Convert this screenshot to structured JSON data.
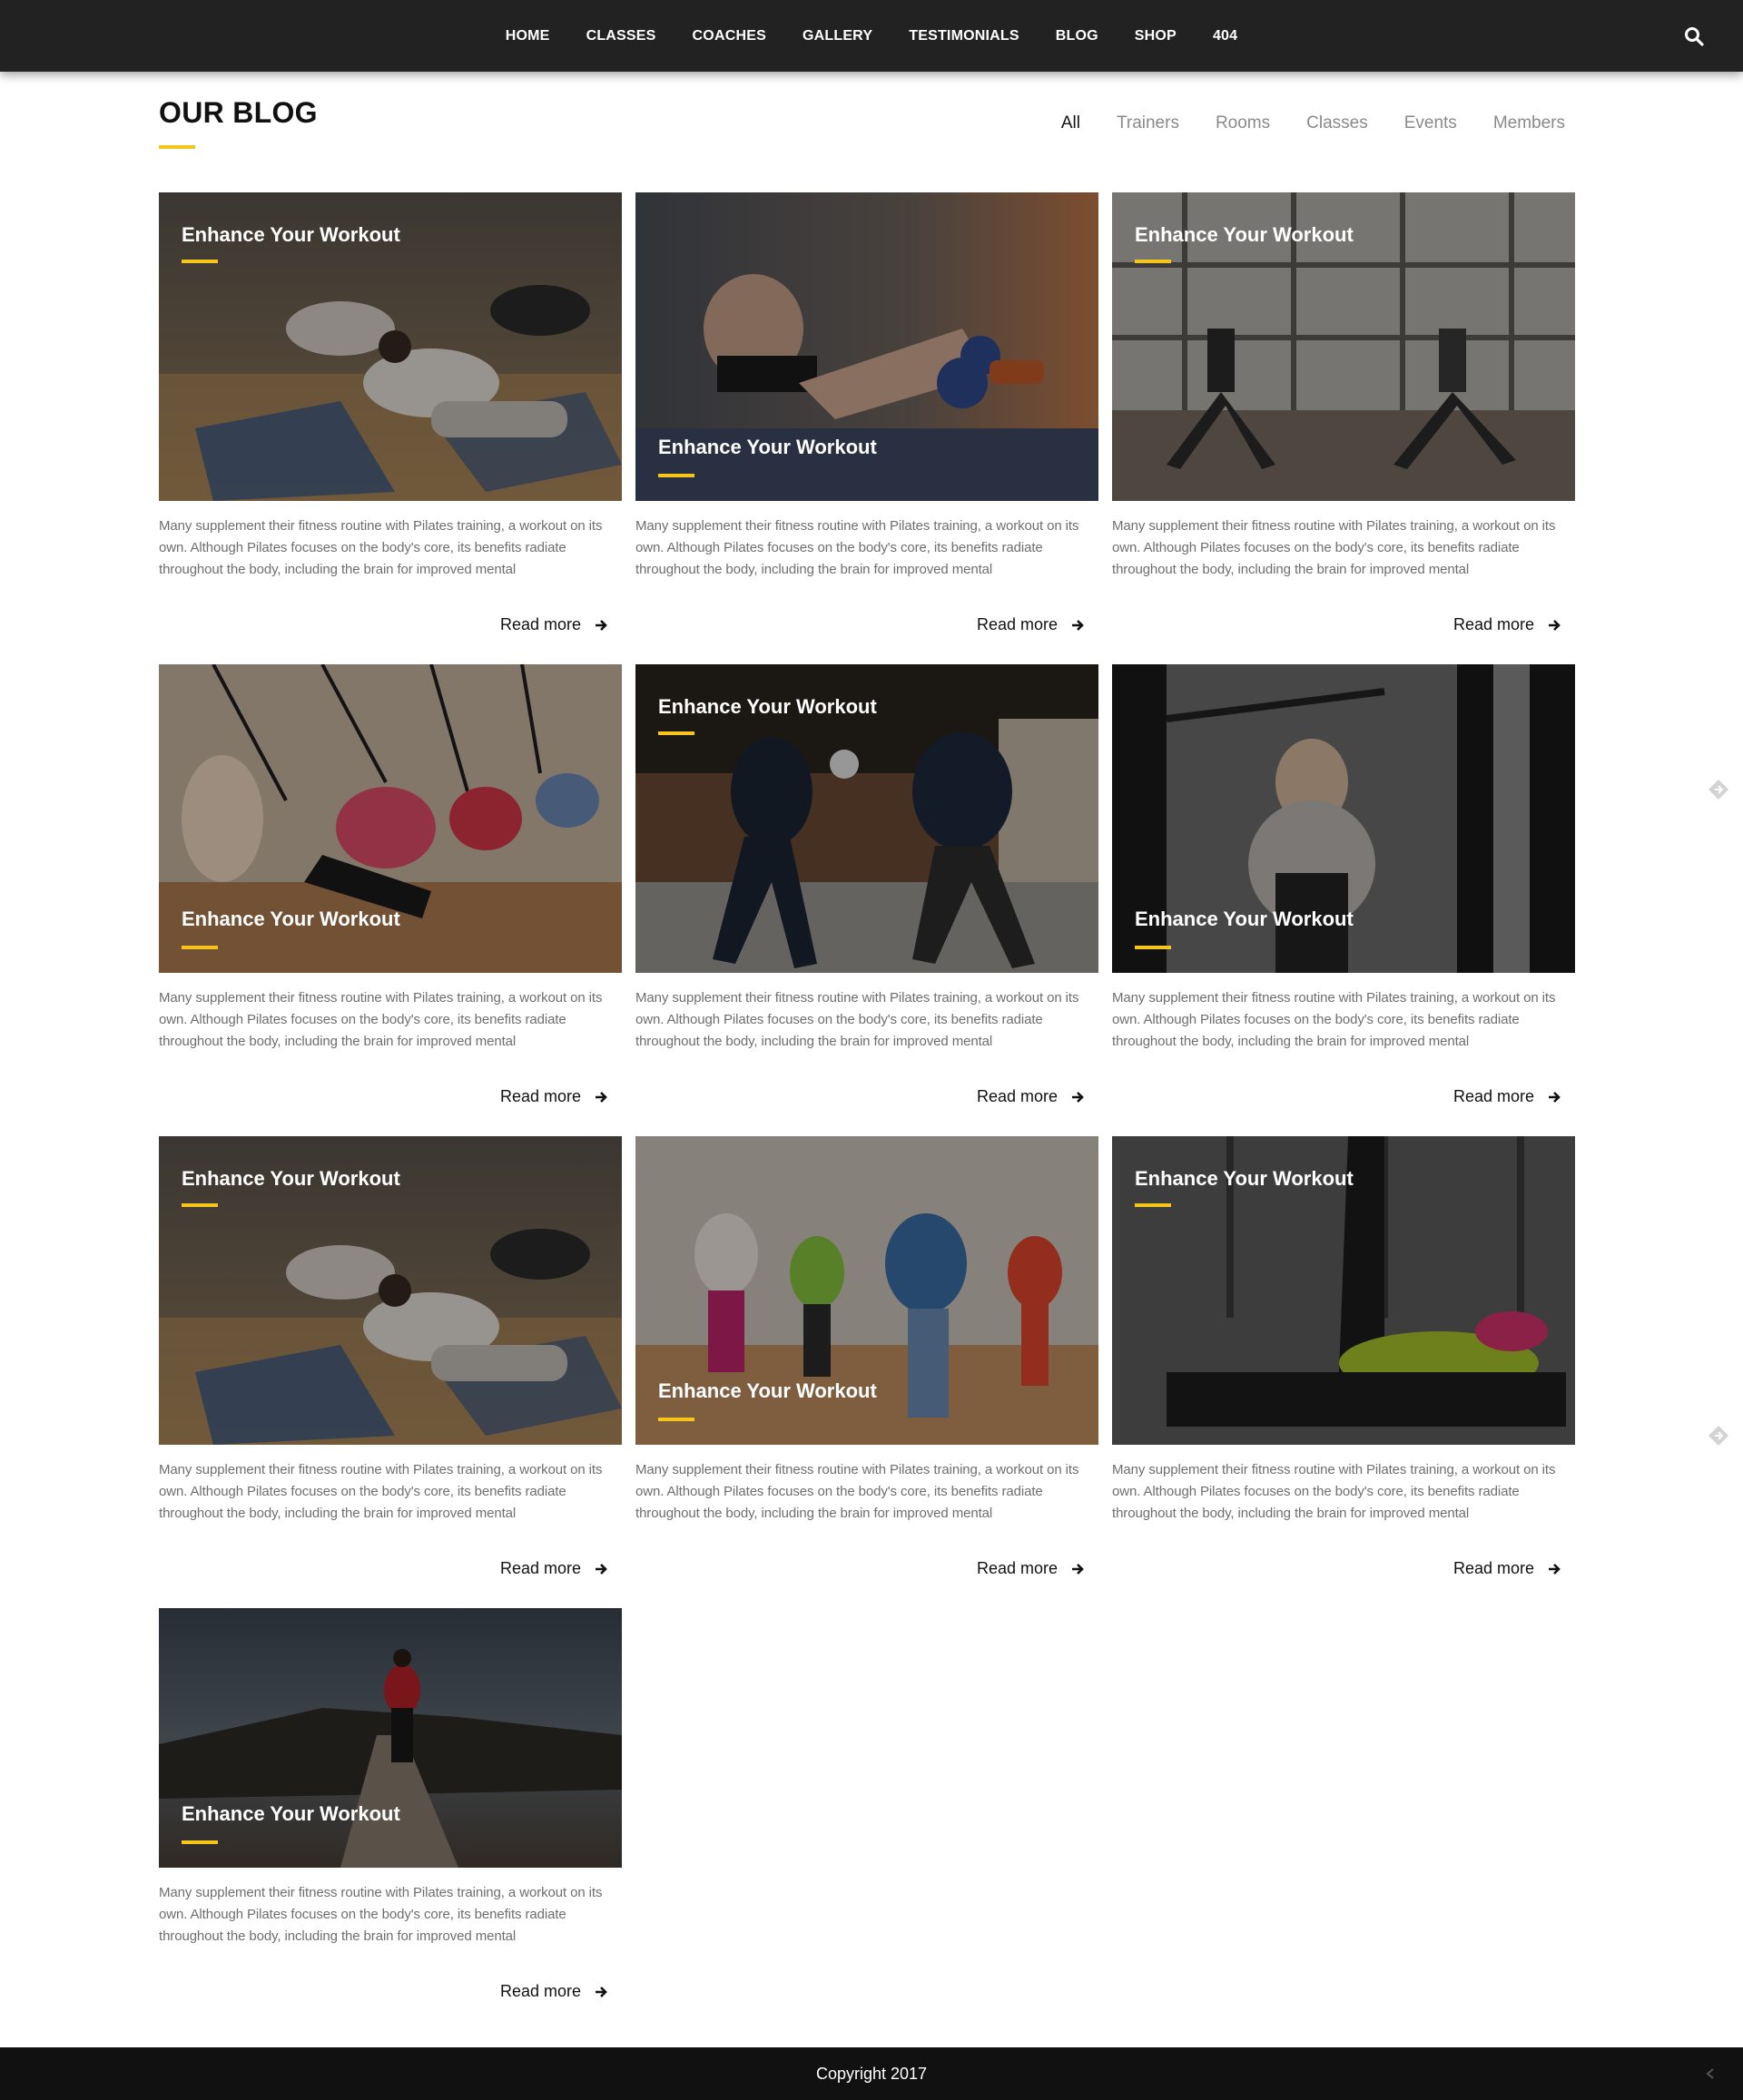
{
  "nav": {
    "items": [
      "HOME",
      "CLASSES",
      "COACHES",
      "GALLERY",
      "TESTIMONIALS",
      "BLOG",
      "SHOP",
      "404"
    ],
    "search_icon": "search-icon"
  },
  "header": {
    "title": "OUR BLOG",
    "accent_color": "#f5c51b"
  },
  "filters": [
    "All",
    "Trainers",
    "Rooms",
    "Classes",
    "Events",
    "Members"
  ],
  "active_filter": "All",
  "posts": [
    {
      "title": "Enhance Your Workout",
      "excerpt": "Many supplement their fitness routine with Pilates training, a workout on its own. Although Pilates focuses on the body's core, its benefits radiate throughout the body, including the brain for improved mental",
      "read_more": "Read more"
    },
    {
      "title": "Enhance Your Workout",
      "excerpt": "Many supplement their fitness routine with Pilates training, a workout on its own. Although Pilates focuses on the body's core, its benefits radiate throughout the body, including the brain for improved mental",
      "read_more": "Read more"
    },
    {
      "title": "Enhance Your Workout",
      "excerpt": "Many supplement their fitness routine with Pilates training, a workout on its own. Although Pilates focuses on the body's core, its benefits radiate throughout the body, including the brain for improved mental",
      "read_more": "Read more"
    },
    {
      "title": "Enhance Your Workout",
      "excerpt": "Many supplement their fitness routine with Pilates training, a workout on its own. Although Pilates focuses on the body's core, its benefits radiate throughout the body, including the brain for improved mental",
      "read_more": "Read more"
    },
    {
      "title": "Enhance Your Workout",
      "excerpt": "Many supplement their fitness routine with Pilates training, a workout on its own. Although Pilates focuses on the body's core, its benefits radiate throughout the body, including the brain for improved mental",
      "read_more": "Read more"
    },
    {
      "title": "Enhance Your Workout",
      "excerpt": "Many supplement their fitness routine with Pilates training, a workout on its own. Although Pilates focuses on the body's core, its benefits radiate throughout the body, including the brain for improved mental",
      "read_more": "Read more"
    },
    {
      "title": "Enhance Your Workout",
      "excerpt": "Many supplement their fitness routine with Pilates training, a workout on its own. Although Pilates focuses on the body's core, its benefits radiate throughout the body, including the brain for improved mental",
      "read_more": "Read more"
    },
    {
      "title": "Enhance Your Workout",
      "excerpt": "Many supplement their fitness routine with Pilates training, a workout on its own. Although Pilates focuses on the body's core, its benefits radiate throughout the body, including the brain for improved mental",
      "read_more": "Read more"
    },
    {
      "title": "Enhance Your Workout",
      "excerpt": "Many supplement their fitness routine with Pilates training, a workout on its own. Although Pilates focuses on the body's core, its benefits radiate throughout the body, including the brain for improved mental",
      "read_more": "Read more"
    },
    {
      "title": "Enhance Your Workout",
      "excerpt": "Many supplement their fitness routine with Pilates training, a workout on its own. Although Pilates focuses on the body's core, its benefits radiate throughout the body, including the brain for improved mental",
      "read_more": "Read more"
    }
  ],
  "footer": {
    "copyright": "Copyright 2017"
  }
}
